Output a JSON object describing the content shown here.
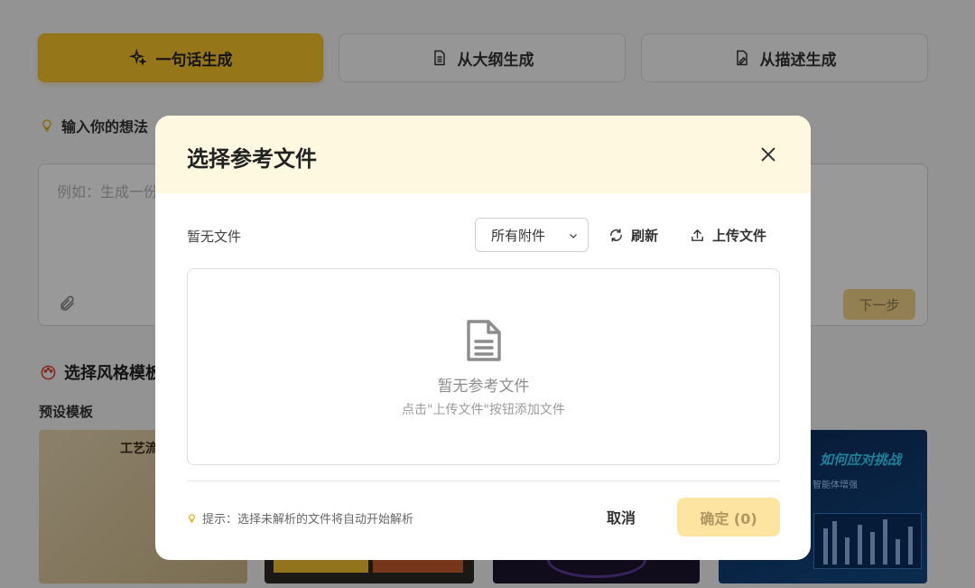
{
  "modes": [
    {
      "label": "一句话生成",
      "icon": "sparkles-icon",
      "active": true
    },
    {
      "label": "从大纲生成",
      "icon": "document-icon",
      "active": false
    },
    {
      "label": "从描述生成",
      "icon": "file-edit-icon",
      "active": false
    }
  ],
  "idea": {
    "label": "输入你的想法",
    "placeholder": "例如：生成一份",
    "next_label": "下一步"
  },
  "style": {
    "title": "选择风格模板",
    "preset_label": "预设模板",
    "thumbnails": [
      {
        "title": "工艺流"
      },
      {
        "title": ""
      },
      {
        "title": ""
      },
      {
        "title": "如何应对挑战",
        "subtitle": "智能体增强"
      }
    ]
  },
  "dialog": {
    "title": "选择参考文件",
    "status": "暂无文件",
    "filter_selected": "所有附件",
    "refresh_label": "刷新",
    "upload_label": "上传文件",
    "empty_title": "暂无参考文件",
    "empty_hint": "点击\"上传文件\"按钮添加文件",
    "tip": "提示：选择未解析的文件将自动开始解析",
    "cancel_label": "取消",
    "confirm_label": "确定 (0)"
  },
  "colors": {
    "accent": "#f8c62c",
    "dialog_header": "#fff8e1",
    "confirm_disabled": "#fde4a0"
  }
}
